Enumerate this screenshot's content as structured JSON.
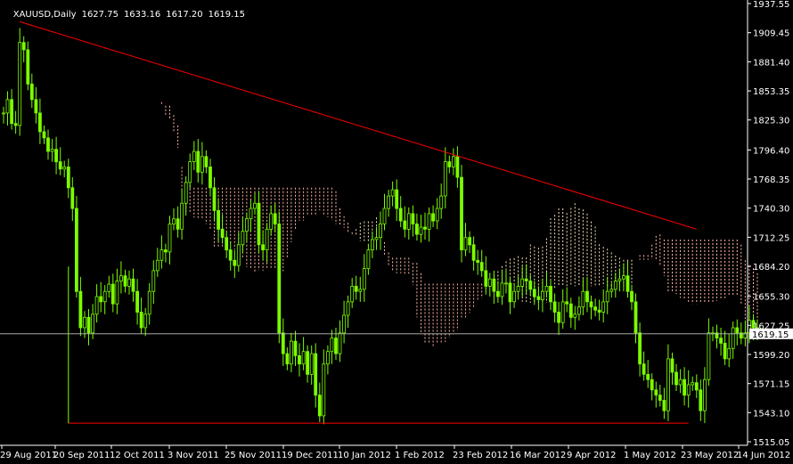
{
  "header": {
    "symbol": "XAUUSD,Daily",
    "open": "1627.75",
    "high": "1633.16",
    "low": "1617.20",
    "close": "1619.15"
  },
  "chart_data": {
    "type": "candlestick",
    "title": "XAUUSD,Daily",
    "price_ticks": [
      "1937.55",
      "1909.45",
      "1881.40",
      "1853.35",
      "1825.30",
      "1796.40",
      "1768.35",
      "1740.30",
      "1712.25",
      "1684.20",
      "1655.30",
      "1627.25",
      "1599.20",
      "1571.15",
      "1543.10",
      "1515.05"
    ],
    "current_price_label": "1619.15",
    "current_price": 1619.15,
    "x_labels": [
      "29 Aug 2011",
      "20 Sep 2011",
      "12 Oct 2011",
      "3 Nov 2011",
      "25 Nov 2011",
      "19 Dec 2011",
      "10 Jan 2012",
      "1 Feb 2012",
      "23 Feb 2012",
      "16 Mar 2012",
      "9 Apr 2012",
      "1 May 2012",
      "23 May 2012",
      "14 Jun 2012"
    ],
    "ylim": [
      1515.05,
      1937.55
    ],
    "grid": false,
    "colors": {
      "background": "#000000",
      "candle": "#7CFC00",
      "cloud": "#F5DEB3",
      "cloud_bearish": "#FFB6A0",
      "trendline": "#FF0000",
      "price_line": "#C0C0C0",
      "axis_text": "#FFFFFF"
    },
    "close_series": [
      1832,
      1845,
      1822,
      1820,
      1900,
      1893,
      1860,
      1845,
      1832,
      1814,
      1808,
      1795,
      1797,
      1785,
      1778,
      1780,
      1760,
      1740,
      1660,
      1625,
      1635,
      1620,
      1638,
      1655,
      1650,
      1660,
      1667,
      1648,
      1670,
      1675,
      1665,
      1672,
      1660,
      1640,
      1625,
      1638,
      1660,
      1680,
      1690,
      1700,
      1698,
      1725,
      1730,
      1720,
      1745,
      1765,
      1785,
      1795,
      1775,
      1790,
      1780,
      1760,
      1738,
      1720,
      1712,
      1700,
      1690,
      1685,
      1705,
      1718,
      1730,
      1740,
      1745,
      1705,
      1700,
      1720,
      1735,
      1725,
      1620,
      1600,
      1590,
      1612,
      1598,
      1590,
      1602,
      1580,
      1600,
      1560,
      1540,
      1590,
      1602,
      1615,
      1600,
      1620,
      1637,
      1650,
      1665,
      1660,
      1662,
      1682,
      1700,
      1710,
      1712,
      1725,
      1740,
      1752,
      1758,
      1740,
      1728,
      1720,
      1735,
      1725,
      1715,
      1722,
      1720,
      1735,
      1728,
      1740,
      1752,
      1785,
      1780,
      1790,
      1770,
      1700,
      1712,
      1705,
      1690,
      1688,
      1680,
      1665,
      1672,
      1660,
      1655,
      1668,
      1668,
      1650,
      1660,
      1665,
      1672,
      1670,
      1662,
      1655,
      1652,
      1660,
      1665,
      1650,
      1640,
      1630,
      1650,
      1648,
      1635,
      1638,
      1645,
      1660,
      1650,
      1645,
      1642,
      1640,
      1650,
      1660,
      1662,
      1670,
      1672,
      1675,
      1660,
      1650,
      1620,
      1590,
      1580,
      1575,
      1565,
      1560,
      1555,
      1545,
      1595,
      1582,
      1570,
      1575,
      1560,
      1570,
      1572,
      1565,
      1545,
      1575,
      1620,
      1620,
      1615,
      1610,
      1595,
      1605,
      1625,
      1620,
      1615,
      1620,
      1632,
      1625,
      1619
    ]
  }
}
